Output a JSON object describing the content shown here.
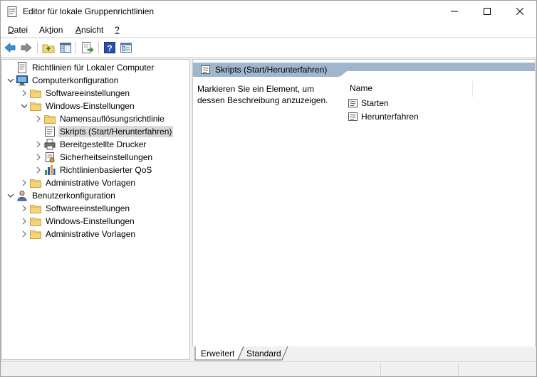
{
  "window": {
    "title": "Editor für lokale Gruppenrichtlinien"
  },
  "menu": [
    {
      "underline": "D",
      "rest": "atei"
    },
    {
      "pre": "Ak",
      "underline": "t",
      "rest": "ion"
    },
    {
      "underline": "A",
      "rest": "nsicht"
    },
    {
      "underline": "?",
      "rest": ""
    }
  ],
  "tree": [
    {
      "label": "Richtlinien für Lokaler Computer",
      "icon": "policy-document-icon",
      "expander": "none"
    },
    {
      "label": "Computerkonfiguration",
      "icon": "computer-icon",
      "expander": "expanded"
    },
    {
      "label": "Softwareeinstellungen",
      "icon": "folder-icon",
      "expander": "collapsed"
    },
    {
      "label": "Windows-Einstellungen",
      "icon": "folder-icon",
      "expander": "expanded"
    },
    {
      "label": "Namensauflösungsrichtlinie",
      "icon": "folder-icon",
      "expander": "collapsed"
    },
    {
      "label": "Skripts (Start/Herunterfahren)",
      "icon": "script-icon",
      "expander": "none",
      "selected": true
    },
    {
      "label": "Bereitgestellte Drucker",
      "icon": "printer-icon",
      "expander": "collapsed"
    },
    {
      "label": "Sicherheitseinstellungen",
      "icon": "security-icon",
      "expander": "collapsed"
    },
    {
      "label": "Richtlinienbasierter QoS",
      "icon": "qos-chart-icon",
      "expander": "collapsed"
    },
    {
      "label": "Administrative Vorlagen",
      "icon": "folder-icon",
      "expander": "collapsed"
    },
    {
      "label": "Benutzerkonfiguration",
      "icon": "user-icon",
      "expander": "expanded"
    },
    {
      "label": "Softwareeinstellungen",
      "icon": "folder-icon",
      "expander": "collapsed"
    },
    {
      "label": "Windows-Einstellungen",
      "icon": "folder-icon",
      "expander": "collapsed"
    },
    {
      "label": "Administrative Vorlagen",
      "icon": "folder-icon",
      "expander": "collapsed"
    }
  ],
  "details": {
    "header": "Skripts (Start/Herunterfahren)",
    "description": "Markieren Sie ein Element, um dessen Beschreibung anzuzeigen.",
    "column_name": "Name",
    "items": [
      "Starten",
      "Herunterfahren"
    ]
  },
  "tabs": [
    "Erweitert",
    "Standard"
  ],
  "colors": {
    "header_band": "#9fb6cd",
    "selection": "#d9d9d9",
    "folder": "#f6d57a"
  }
}
